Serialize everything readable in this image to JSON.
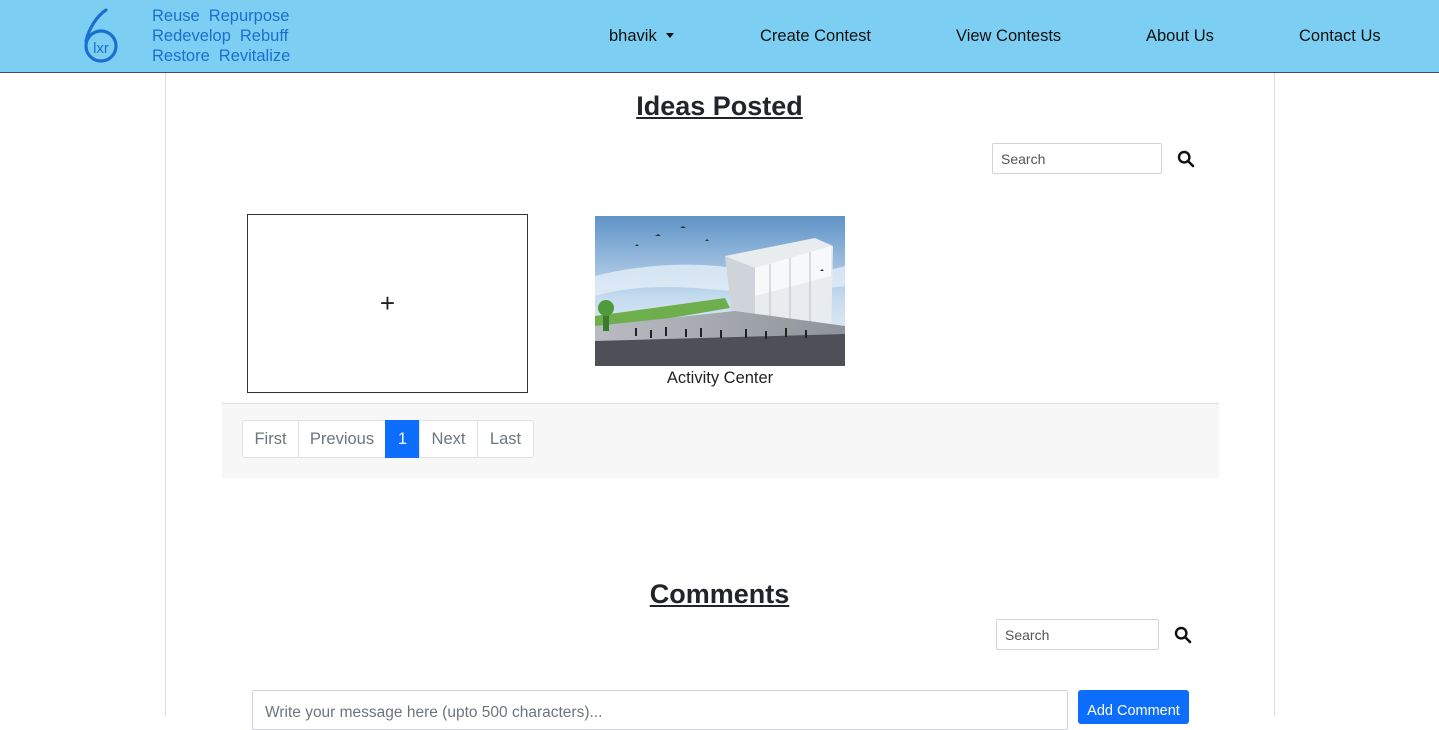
{
  "brand": {
    "logo_text": "lxr",
    "tagline": [
      [
        "Reuse",
        "Repurpose"
      ],
      [
        "Redevelop",
        "Rebuff"
      ],
      [
        "Restore",
        "Revitalize"
      ]
    ]
  },
  "nav": {
    "user": "bhavik",
    "create_contest": "Create Contest",
    "view_contests": "View Contests",
    "about": "About Us",
    "contact": "Contact Us"
  },
  "ideas": {
    "title": "Ideas Posted",
    "search_placeholder": "Search",
    "add_symbol": "+",
    "cards": [
      {
        "caption": "Activity Center"
      }
    ]
  },
  "pagination": {
    "first": "First",
    "previous": "Previous",
    "current": "1",
    "next": "Next",
    "last": "Last"
  },
  "comments": {
    "title": "Comments",
    "search_placeholder": "Search",
    "input_placeholder": "Write your message here (upto 500 characters)...",
    "add_button": "Add Comment"
  },
  "colors": {
    "navbar": "#7ccff2",
    "brand_blue": "#1a6fd1",
    "primary": "#0d6efd"
  }
}
